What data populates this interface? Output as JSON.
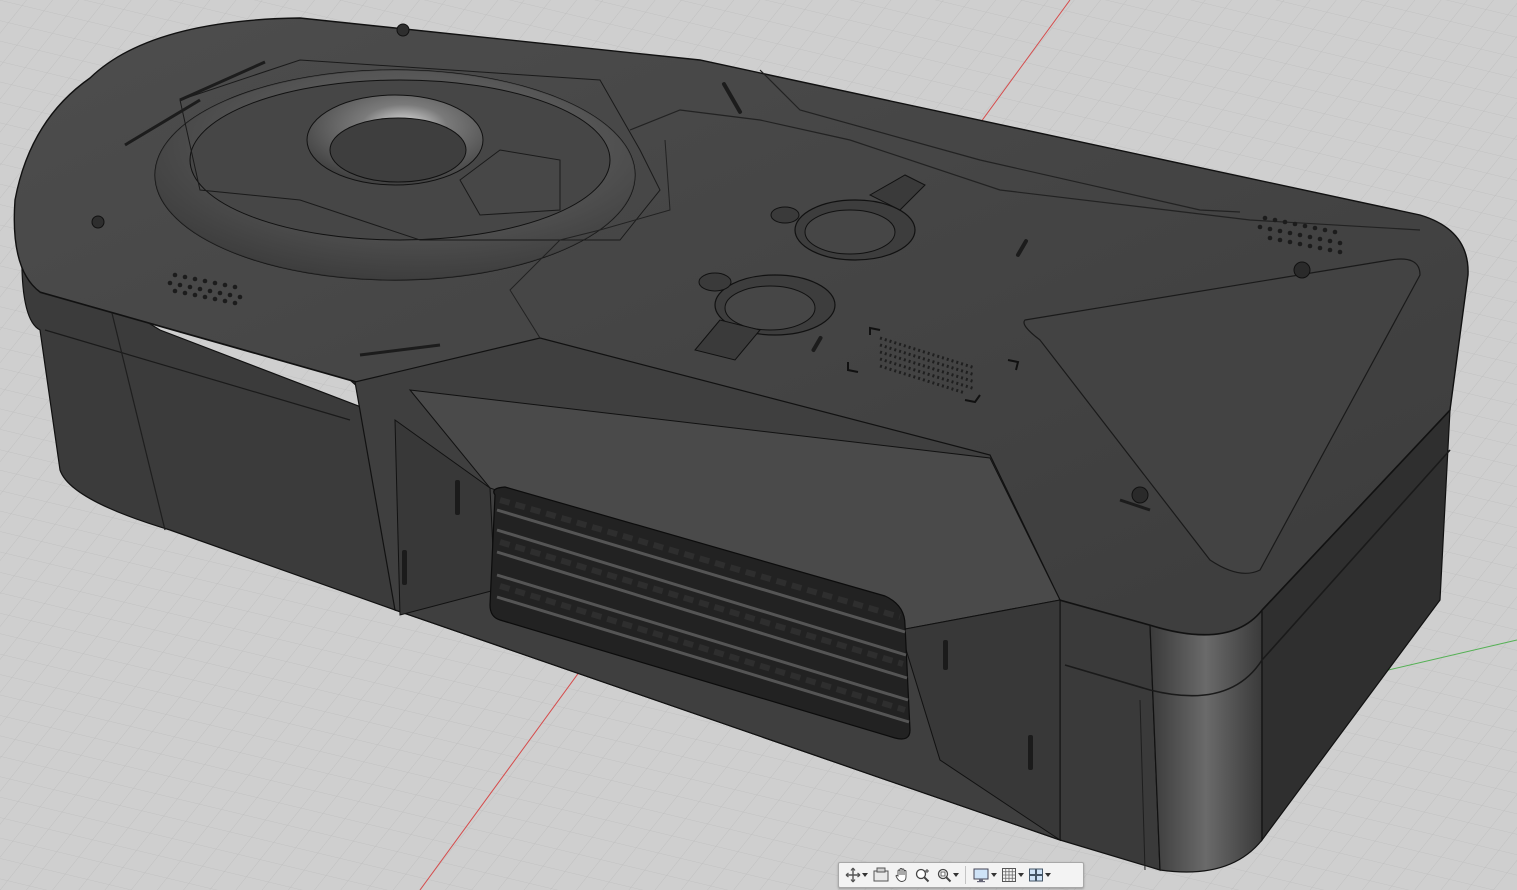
{
  "viewport": {
    "background_color": "#cfcfcf",
    "grid_color": "#b7b7b7",
    "x_axis_color": "#d64b4b",
    "y_axis_color": "#53b053",
    "model_color": "#454545"
  },
  "nav_toolbar": {
    "items": [
      {
        "name": "orbit-icon",
        "has_menu": true
      },
      {
        "name": "look-at-icon",
        "has_menu": false
      },
      {
        "name": "pan-hand-icon",
        "has_menu": false
      },
      {
        "name": "zoom-icon",
        "has_menu": false
      },
      {
        "name": "fit-zoom-icon",
        "has_menu": true
      },
      {
        "name": "display-settings-icon",
        "has_menu": true
      },
      {
        "name": "grid-snaps-icon",
        "has_menu": true
      },
      {
        "name": "viewports-icon",
        "has_menu": true
      }
    ]
  }
}
